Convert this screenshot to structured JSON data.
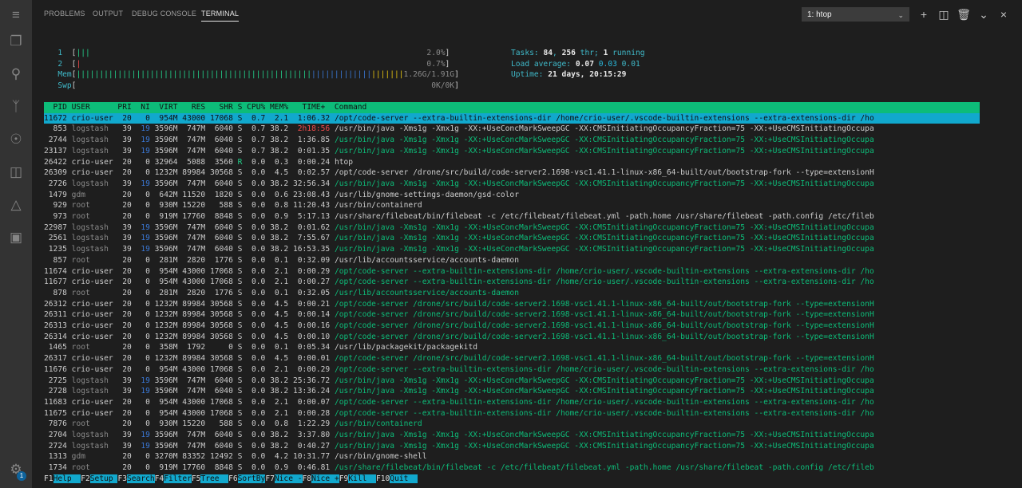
{
  "panel": {
    "tabs": [
      "PROBLEMS",
      "OUTPUT",
      "DEBUG CONSOLE",
      "TERMINAL"
    ],
    "active_tab": "TERMINAL",
    "terminal_select": "1: htop"
  },
  "activity_icons": [
    "menu-icon",
    "explorer-icon",
    "search-icon",
    "source-control-icon",
    "debug-icon",
    "extensions-icon",
    "testing-icon",
    "remote-explorer-icon",
    "settings-gear-icon"
  ],
  "meters": {
    "cpu1": {
      "label": "1",
      "bars": "|||",
      "value": "2.0%"
    },
    "cpu2": {
      "label": "2",
      "bars": "|",
      "value": "0.7%"
    },
    "mem": {
      "label": "Mem",
      "value": "1.26G/1.91G"
    },
    "swp": {
      "label": "Swp",
      "value": "0K/0K"
    }
  },
  "summary": {
    "tasks_label": "Tasks:",
    "tasks": "84",
    "thr": "256",
    "thr_label": "thr;",
    "running": "1",
    "running_label": "running",
    "load_label": "Load average:",
    "load1": "0.07",
    "load5": "0.03",
    "load15": "0.01",
    "uptime_label": "Uptime:",
    "uptime": "21 days, 20:15:29"
  },
  "columns": "  PID USER      PRI  NI  VIRT   RES   SHR S CPU% MEM%   TIME+  Command",
  "processes": [
    {
      "pid": "11672",
      "user": "crio-user",
      "pri": "20",
      "ni": "0",
      "virt": "954M",
      "res": "43000",
      "shr": "17068",
      "s": "S",
      "cpu": "0.7",
      "mem": "2.1",
      "time": "1:06.32",
      "cmd": "/opt/code-server --extra-builtin-extensions-dir /home/crio-user/.vscode-builtin-extensions --extra-extensions-dir /ho",
      "sel": true
    },
    {
      "pid": "853",
      "user": "logstash",
      "pri": "39",
      "ni": "19",
      "virt": "3596M",
      "res": "747M",
      "shr": "6040",
      "s": "S",
      "cpu": "0.7",
      "mem": "38.2",
      "time": "2h18:56",
      "cmd": "/usr/bin/java -Xms1g -Xmx1g -XX:+UseConcMarkSweepGC -XX:CMSInitiatingOccupancyFraction=75 -XX:+UseCMSInitiatingOccupa"
    },
    {
      "pid": "2744",
      "user": "logstash",
      "pri": "39",
      "ni": "19",
      "virt": "3596M",
      "res": "747M",
      "shr": "6040",
      "s": "S",
      "cpu": "0.7",
      "mem": "38.2",
      "time": "1:36.85",
      "cmd": "/usr/bin/java -Xms1g -Xmx1g -XX:+UseConcMarkSweepGC -XX:CMSInitiatingOccupancyFraction=75 -XX:+UseCMSInitiatingOccupa",
      "thread": true
    },
    {
      "pid": "23137",
      "user": "logstash",
      "pri": "39",
      "ni": "19",
      "virt": "3596M",
      "res": "747M",
      "shr": "6040",
      "s": "S",
      "cpu": "0.7",
      "mem": "38.2",
      "time": "0:01.35",
      "cmd": "/usr/bin/java -Xms1g -Xmx1g -XX:+UseConcMarkSweepGC -XX:CMSInitiatingOccupancyFraction=75 -XX:+UseCMSInitiatingOccupa",
      "thread": true
    },
    {
      "pid": "26422",
      "user": "crio-user",
      "pri": "20",
      "ni": "0",
      "virt": "32964",
      "res": "5088",
      "shr": "3560",
      "s": "R",
      "cpu": "0.0",
      "mem": "0.3",
      "time": "0:00.24",
      "cmd": "htop"
    },
    {
      "pid": "26309",
      "user": "crio-user",
      "pri": "20",
      "ni": "0",
      "virt": "1232M",
      "res": "89984",
      "shr": "30568",
      "s": "S",
      "cpu": "0.0",
      "mem": "4.5",
      "time": "0:02.57",
      "cmd": "/opt/code-server /drone/src/build/code-server2.1698-vsc1.41.1-linux-x86_64-built/out/bootstrap-fork --type=extensionH"
    },
    {
      "pid": "2726",
      "user": "logstash",
      "pri": "39",
      "ni": "19",
      "virt": "3596M",
      "res": "747M",
      "shr": "6040",
      "s": "S",
      "cpu": "0.0",
      "mem": "38.2",
      "time": "32:56.34",
      "cmd": "/usr/bin/java -Xms1g -Xmx1g -XX:+UseConcMarkSweepGC -XX:CMSInitiatingOccupancyFraction=75 -XX:+UseCMSInitiatingOccupa",
      "thread": true
    },
    {
      "pid": "1479",
      "user": "gdm",
      "pri": "20",
      "ni": "0",
      "virt": "642M",
      "res": "11520",
      "shr": "1820",
      "s": "S",
      "cpu": "0.0",
      "mem": "0.6",
      "time": "23:08.43",
      "cmd": "/usr/lib/gnome-settings-daemon/gsd-color"
    },
    {
      "pid": "929",
      "user": "root",
      "pri": "20",
      "ni": "0",
      "virt": "930M",
      "res": "15220",
      "shr": "588",
      "s": "S",
      "cpu": "0.0",
      "mem": "0.8",
      "time": "11:20.43",
      "cmd": "/usr/bin/containerd"
    },
    {
      "pid": "973",
      "user": "root",
      "pri": "20",
      "ni": "0",
      "virt": "919M",
      "res": "17760",
      "shr": "8848",
      "s": "S",
      "cpu": "0.0",
      "mem": "0.9",
      "time": "5:17.13",
      "cmd": "/usr/share/filebeat/bin/filebeat -c /etc/filebeat/filebeat.yml -path.home /usr/share/filebeat -path.config /etc/fileb"
    },
    {
      "pid": "22987",
      "user": "logstash",
      "pri": "39",
      "ni": "19",
      "virt": "3596M",
      "res": "747M",
      "shr": "6040",
      "s": "S",
      "cpu": "0.0",
      "mem": "38.2",
      "time": "0:01.62",
      "cmd": "/usr/bin/java -Xms1g -Xmx1g -XX:+UseConcMarkSweepGC -XX:CMSInitiatingOccupancyFraction=75 -XX:+UseCMSInitiatingOccupa",
      "thread": true
    },
    {
      "pid": "2561",
      "user": "logstash",
      "pri": "39",
      "ni": "19",
      "virt": "3596M",
      "res": "747M",
      "shr": "6040",
      "s": "S",
      "cpu": "0.0",
      "mem": "38.2",
      "time": "7:55.67",
      "cmd": "/usr/bin/java -Xms1g -Xmx1g -XX:+UseConcMarkSweepGC -XX:CMSInitiatingOccupancyFraction=75 -XX:+UseCMSInitiatingOccupa",
      "thread": true
    },
    {
      "pid": "1235",
      "user": "logstash",
      "pri": "39",
      "ni": "19",
      "virt": "3596M",
      "res": "747M",
      "shr": "6040",
      "s": "S",
      "cpu": "0.0",
      "mem": "38.2",
      "time": "16:53.35",
      "cmd": "/usr/bin/java -Xms1g -Xmx1g -XX:+UseConcMarkSweepGC -XX:CMSInitiatingOccupancyFraction=75 -XX:+UseCMSInitiatingOccupa",
      "thread": true
    },
    {
      "pid": "857",
      "user": "root",
      "pri": "20",
      "ni": "0",
      "virt": "281M",
      "res": "2820",
      "shr": "1776",
      "s": "S",
      "cpu": "0.0",
      "mem": "0.1",
      "time": "0:32.09",
      "cmd": "/usr/lib/accountsservice/accounts-daemon"
    },
    {
      "pid": "11674",
      "user": "crio-user",
      "pri": "20",
      "ni": "0",
      "virt": "954M",
      "res": "43000",
      "shr": "17068",
      "s": "S",
      "cpu": "0.0",
      "mem": "2.1",
      "time": "0:00.29",
      "cmd": "/opt/code-server --extra-builtin-extensions-dir /home/crio-user/.vscode-builtin-extensions --extra-extensions-dir /ho",
      "thread": true
    },
    {
      "pid": "11677",
      "user": "crio-user",
      "pri": "20",
      "ni": "0",
      "virt": "954M",
      "res": "43000",
      "shr": "17068",
      "s": "S",
      "cpu": "0.0",
      "mem": "2.1",
      "time": "0:00.27",
      "cmd": "/opt/code-server --extra-builtin-extensions-dir /home/crio-user/.vscode-builtin-extensions --extra-extensions-dir /ho",
      "thread": true
    },
    {
      "pid": "878",
      "user": "root",
      "pri": "20",
      "ni": "0",
      "virt": "281M",
      "res": "2820",
      "shr": "1776",
      "s": "S",
      "cpu": "0.0",
      "mem": "0.1",
      "time": "0:32.05",
      "cmd": "/usr/lib/accountsservice/accounts-daemon",
      "thread": true
    },
    {
      "pid": "26312",
      "user": "crio-user",
      "pri": "20",
      "ni": "0",
      "virt": "1232M",
      "res": "89984",
      "shr": "30568",
      "s": "S",
      "cpu": "0.0",
      "mem": "4.5",
      "time": "0:00.21",
      "cmd": "/opt/code-server /drone/src/build/code-server2.1698-vsc1.41.1-linux-x86_64-built/out/bootstrap-fork --type=extensionH",
      "thread": true
    },
    {
      "pid": "26311",
      "user": "crio-user",
      "pri": "20",
      "ni": "0",
      "virt": "1232M",
      "res": "89984",
      "shr": "30568",
      "s": "S",
      "cpu": "0.0",
      "mem": "4.5",
      "time": "0:00.14",
      "cmd": "/opt/code-server /drone/src/build/code-server2.1698-vsc1.41.1-linux-x86_64-built/out/bootstrap-fork --type=extensionH",
      "thread": true
    },
    {
      "pid": "26313",
      "user": "crio-user",
      "pri": "20",
      "ni": "0",
      "virt": "1232M",
      "res": "89984",
      "shr": "30568",
      "s": "S",
      "cpu": "0.0",
      "mem": "4.5",
      "time": "0:00.16",
      "cmd": "/opt/code-server /drone/src/build/code-server2.1698-vsc1.41.1-linux-x86_64-built/out/bootstrap-fork --type=extensionH",
      "thread": true
    },
    {
      "pid": "26314",
      "user": "crio-user",
      "pri": "20",
      "ni": "0",
      "virt": "1232M",
      "res": "89984",
      "shr": "30568",
      "s": "S",
      "cpu": "0.0",
      "mem": "4.5",
      "time": "0:00.10",
      "cmd": "/opt/code-server /drone/src/build/code-server2.1698-vsc1.41.1-linux-x86_64-built/out/bootstrap-fork --type=extensionH",
      "thread": true
    },
    {
      "pid": "1465",
      "user": "root",
      "pri": "20",
      "ni": "0",
      "virt": "358M",
      "res": "1792",
      "shr": "0",
      "s": "S",
      "cpu": "0.0",
      "mem": "0.1",
      "time": "0:05.34",
      "cmd": "/usr/lib/packagekit/packagekitd"
    },
    {
      "pid": "26317",
      "user": "crio-user",
      "pri": "20",
      "ni": "0",
      "virt": "1232M",
      "res": "89984",
      "shr": "30568",
      "s": "S",
      "cpu": "0.0",
      "mem": "4.5",
      "time": "0:00.01",
      "cmd": "/opt/code-server /drone/src/build/code-server2.1698-vsc1.41.1-linux-x86_64-built/out/bootstrap-fork --type=extensionH",
      "thread": true
    },
    {
      "pid": "11676",
      "user": "crio-user",
      "pri": "20",
      "ni": "0",
      "virt": "954M",
      "res": "43000",
      "shr": "17068",
      "s": "S",
      "cpu": "0.0",
      "mem": "2.1",
      "time": "0:00.29",
      "cmd": "/opt/code-server --extra-builtin-extensions-dir /home/crio-user/.vscode-builtin-extensions --extra-extensions-dir /ho",
      "thread": true
    },
    {
      "pid": "2725",
      "user": "logstash",
      "pri": "39",
      "ni": "19",
      "virt": "3596M",
      "res": "747M",
      "shr": "6040",
      "s": "S",
      "cpu": "0.0",
      "mem": "38.2",
      "time": "25:36.72",
      "cmd": "/usr/bin/java -Xms1g -Xmx1g -XX:+UseConcMarkSweepGC -XX:CMSInitiatingOccupancyFraction=75 -XX:+UseCMSInitiatingOccupa",
      "thread": true
    },
    {
      "pid": "2728",
      "user": "logstash",
      "pri": "39",
      "ni": "19",
      "virt": "3596M",
      "res": "747M",
      "shr": "6040",
      "s": "S",
      "cpu": "0.0",
      "mem": "38.2",
      "time": "13:36.24",
      "cmd": "/usr/bin/java -Xms1g -Xmx1g -XX:+UseConcMarkSweepGC -XX:CMSInitiatingOccupancyFraction=75 -XX:+UseCMSInitiatingOccupa",
      "thread": true
    },
    {
      "pid": "11683",
      "user": "crio-user",
      "pri": "20",
      "ni": "0",
      "virt": "954M",
      "res": "43000",
      "shr": "17068",
      "s": "S",
      "cpu": "0.0",
      "mem": "2.1",
      "time": "0:00.07",
      "cmd": "/opt/code-server --extra-builtin-extensions-dir /home/crio-user/.vscode-builtin-extensions --extra-extensions-dir /ho",
      "thread": true
    },
    {
      "pid": "11675",
      "user": "crio-user",
      "pri": "20",
      "ni": "0",
      "virt": "954M",
      "res": "43000",
      "shr": "17068",
      "s": "S",
      "cpu": "0.0",
      "mem": "2.1",
      "time": "0:00.28",
      "cmd": "/opt/code-server --extra-builtin-extensions-dir /home/crio-user/.vscode-builtin-extensions --extra-extensions-dir /ho",
      "thread": true
    },
    {
      "pid": "7876",
      "user": "root",
      "pri": "20",
      "ni": "0",
      "virt": "930M",
      "res": "15220",
      "shr": "588",
      "s": "S",
      "cpu": "0.0",
      "mem": "0.8",
      "time": "1:22.29",
      "cmd": "/usr/bin/containerd",
      "thread": true
    },
    {
      "pid": "2704",
      "user": "logstash",
      "pri": "39",
      "ni": "19",
      "virt": "3596M",
      "res": "747M",
      "shr": "6040",
      "s": "S",
      "cpu": "0.0",
      "mem": "38.2",
      "time": "3:37.80",
      "cmd": "/usr/bin/java -Xms1g -Xmx1g -XX:+UseConcMarkSweepGC -XX:CMSInitiatingOccupancyFraction=75 -XX:+UseCMSInitiatingOccupa",
      "thread": true
    },
    {
      "pid": "2724",
      "user": "logstash",
      "pri": "39",
      "ni": "19",
      "virt": "3596M",
      "res": "747M",
      "shr": "6040",
      "s": "S",
      "cpu": "0.0",
      "mem": "38.2",
      "time": "0:40.27",
      "cmd": "/usr/bin/java -Xms1g -Xmx1g -XX:+UseConcMarkSweepGC -XX:CMSInitiatingOccupancyFraction=75 -XX:+UseCMSInitiatingOccupa",
      "thread": true
    },
    {
      "pid": "1313",
      "user": "gdm",
      "pri": "20",
      "ni": "0",
      "virt": "3270M",
      "res": "83352",
      "shr": "12492",
      "s": "S",
      "cpu": "0.0",
      "mem": "4.2",
      "time": "10:31.77",
      "cmd": "/usr/bin/gnome-shell"
    },
    {
      "pid": "1734",
      "user": "root",
      "pri": "20",
      "ni": "0",
      "virt": "919M",
      "res": "17760",
      "shr": "8848",
      "s": "S",
      "cpu": "0.0",
      "mem": "0.9",
      "time": "0:46.81",
      "cmd": "/usr/share/filebeat/bin/filebeat -c /etc/filebeat/filebeat.yml -path.home /usr/share/filebeat -path.config /etc/fileb",
      "thread": true
    }
  ],
  "function_keys": [
    {
      "key": "F1",
      "label": "Help  "
    },
    {
      "key": "F2",
      "label": "Setup "
    },
    {
      "key": "F3",
      "label": "Search"
    },
    {
      "key": "F4",
      "label": "Filter"
    },
    {
      "key": "F5",
      "label": "Tree  "
    },
    {
      "key": "F6",
      "label": "SortBy"
    },
    {
      "key": "F7",
      "label": "Nice -"
    },
    {
      "key": "F8",
      "label": "Nice +"
    },
    {
      "key": "F9",
      "label": "Kill  "
    },
    {
      "key": "F10",
      "label": "Quit  "
    }
  ]
}
